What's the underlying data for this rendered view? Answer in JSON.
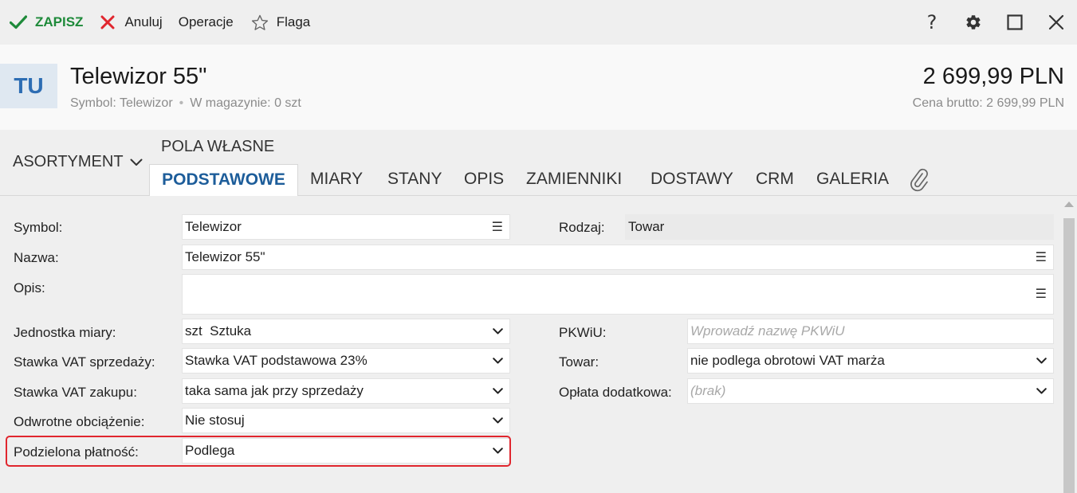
{
  "toolbar": {
    "save_label": "ZAPISZ",
    "cancel_label": "Anuluj",
    "operations_label": "Operacje",
    "flag_label": "Flaga",
    "help_label": "?"
  },
  "colors": {
    "save_green": "#1e8a3a",
    "cancel_red": "#e0262e",
    "accent_blue": "#1d5d9a",
    "highlight_border": "#e0262e"
  },
  "header": {
    "avatar_initials": "TU",
    "title": "Telewizor 55\"",
    "symbol_text": "Symbol: Telewizor",
    "stock_text": "W magazynie: 0 szt",
    "separator": "•",
    "price": "2 699,99 PLN",
    "gross_price_text": "Cena brutto: 2 699,99 PLN"
  },
  "tabs": {
    "assortment_label": "ASORTYMENT",
    "custom_fields_label": "POLA WŁASNE",
    "items": [
      {
        "label": "PODSTAWOWE",
        "active": true
      },
      {
        "label": "MIARY"
      },
      {
        "label": "STANY"
      },
      {
        "label": "OPIS"
      },
      {
        "label": "ZAMIENNIKI"
      },
      {
        "label": "DOSTAWY"
      },
      {
        "label": "CRM"
      },
      {
        "label": "GALERIA"
      }
    ]
  },
  "form": {
    "symbol": {
      "label": "Symbol:",
      "value": "Telewizor"
    },
    "type": {
      "label": "Rodzaj:",
      "value": "Towar"
    },
    "name": {
      "label": "Nazwa:",
      "value": "Telewizor 55\""
    },
    "description": {
      "label": "Opis:",
      "value": ""
    },
    "unit": {
      "label": "Jednostka miary:",
      "value": "szt  Sztuka"
    },
    "pkwiu": {
      "label": "PKWiU:",
      "value": "",
      "placeholder": "Wprowadź nazwę PKWiU"
    },
    "vat_sale": {
      "label": "Stawka VAT sprzedaży:",
      "value": "Stawka VAT podstawowa 23%"
    },
    "goods": {
      "label": "Towar:",
      "value": "nie podlega obrotowi VAT marża"
    },
    "vat_purchase": {
      "label": "Stawka VAT zakupu:",
      "value": "taka sama jak przy sprzedaży"
    },
    "extra_fee": {
      "label": "Opłata dodatkowa:",
      "value": "(brak)"
    },
    "reverse_charge": {
      "label": "Odwrotne obciążenie:",
      "value": "Nie stosuj"
    },
    "split_payment": {
      "label": "Podzielona płatność:",
      "value": "Podlega"
    }
  }
}
